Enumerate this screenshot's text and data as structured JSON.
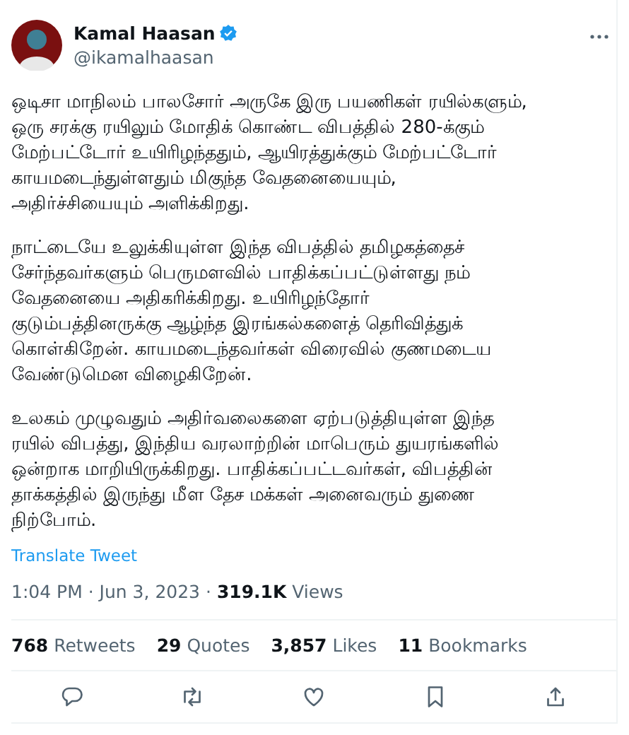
{
  "author": {
    "name": "Kamal Haasan",
    "handle": "@ikamalhaasan",
    "verified": true
  },
  "paragraphs": [
    "ஒடிசா மாநிலம் பாலசோர் அருகே இரு பயணிகள் ரயில்களும்,\nஒரு சரக்கு ரயிலும் மோதிக் கொண்ட விபத்தில் 280-க்கும்\nமேற்பட்டோர் உயிரிழந்ததும், ஆயிரத்துக்கும் மேற்பட்டோர்\nகாயமடைந்துள்ளதும் மிகுந்த வேதனையையும்,\nஅதிர்ச்சியையும் அளிக்கிறது.",
    "நாட்டையே உலுக்கியுள்ள இந்த விபத்தில் தமிழகத்தைச்\nசேர்ந்தவர்களும் பெருமளவில் பாதிக்கப்பட்டுள்ளது நம்\nவேதனையை அதிகரிக்கிறது. உயிரிழந்தோர்\nகுடும்பத்தினருக்கு ஆழ்ந்த இரங்கல்களைத் தெரிவித்துக்\nகொள்கிறேன். காயமடைந்தவர்கள் விரைவில் குணமடைய\nவேண்டுமென விழைகிறேன்.",
    "உலகம் முழுவதும் அதிர்வலைகளை ஏற்படுத்தியுள்ள இந்த\nரயில் விபத்து, இந்திய வரலாற்றின் மாபெரும் துயரங்களில்\nஒன்றாக மாறியிருக்கிறது. பாதிக்கப்பட்டவர்கள், விபத்தின்\nதாக்கத்தில் இருந்து மீள தேச மக்கள் அனைவரும் துணை\nநிற்போம்."
  ],
  "translate_link": "Translate Tweet",
  "meta": "1:04 PM · Jun 3, 2023 · **319.1K** Views",
  "stats": [
    "**768** Retweets",
    "**29** Quotes",
    "**3,857** Likes",
    "**11** Bookmarks"
  ],
  "actions": [
    {
      "kind": "reply"
    },
    {
      "kind": "retweet"
    },
    {
      "kind": "like"
    },
    {
      "kind": "bookmark"
    },
    {
      "kind": "share"
    }
  ]
}
